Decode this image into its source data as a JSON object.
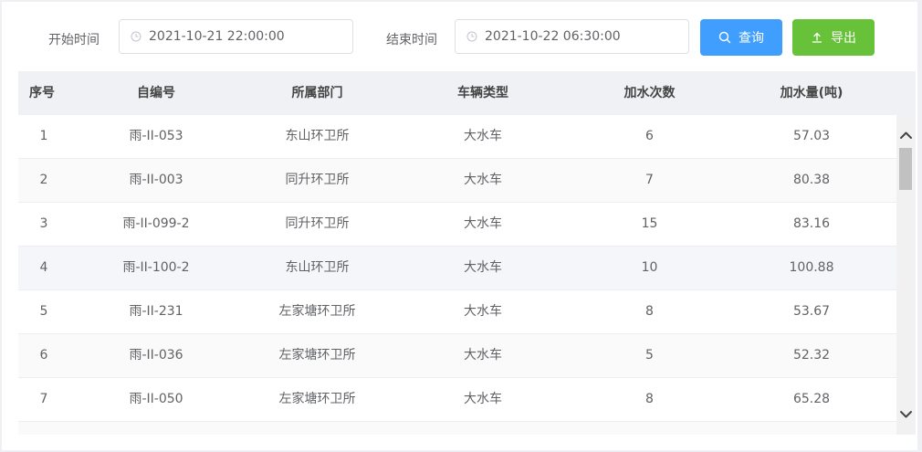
{
  "filters": {
    "start_label": "开始时间",
    "start_value": "2021-10-21 22:00:00",
    "end_label": "结束时间",
    "end_value": "2021-10-22 06:30:00",
    "query_label": "查询",
    "export_label": "导出"
  },
  "colors": {
    "query": "#409eff",
    "export": "#67c23a"
  },
  "table": {
    "headers": [
      "序号",
      "自编号",
      "所属部门",
      "车辆类型",
      "加水次数",
      "加水量(吨)"
    ],
    "rows": [
      [
        "1",
        "雨-II-053",
        "东山环卫所",
        "大水车",
        "6",
        "57.03"
      ],
      [
        "2",
        "雨-II-003",
        "同升环卫所",
        "大水车",
        "7",
        "80.38"
      ],
      [
        "3",
        "雨-II-099-2",
        "同升环卫所",
        "大水车",
        "15",
        "83.16"
      ],
      [
        "4",
        "雨-II-100-2",
        "东山环卫所",
        "大水车",
        "10",
        "100.88"
      ],
      [
        "5",
        "雨-II-231",
        "左家塘环卫所",
        "大水车",
        "8",
        "53.67"
      ],
      [
        "6",
        "雨-II-036",
        "左家塘环卫所",
        "大水车",
        "5",
        "52.32"
      ],
      [
        "7",
        "雨-II-050",
        "左家塘环卫所",
        "大水车",
        "8",
        "65.28"
      ]
    ]
  }
}
